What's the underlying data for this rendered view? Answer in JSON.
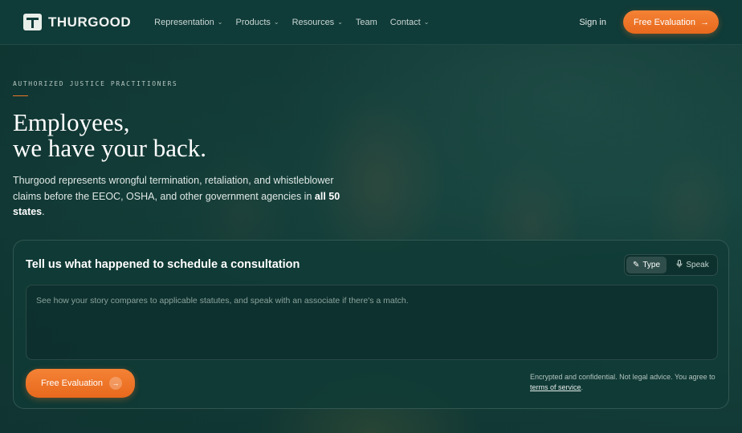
{
  "brand": {
    "name": "THURGOOD"
  },
  "nav": {
    "items": [
      {
        "label": "Representation",
        "has_dropdown": true
      },
      {
        "label": "Products",
        "has_dropdown": true
      },
      {
        "label": "Resources",
        "has_dropdown": true
      },
      {
        "label": "Team",
        "has_dropdown": false
      },
      {
        "label": "Contact",
        "has_dropdown": true
      }
    ],
    "signin_label": "Sign in",
    "cta_label": "Free Evaluation"
  },
  "hero": {
    "eyebrow": "AUTHORIZED JUSTICE PRACTITIONERS",
    "headline_line1": "Employees,",
    "headline_line2": "we have your back.",
    "subtext_prefix": "Thurgood represents wrongful termination, retaliation, and whistleblower claims before the EEOC, OSHA, and other government agencies in ",
    "subtext_bold": "all 50 states",
    "subtext_suffix": "."
  },
  "consultation": {
    "title": "Tell us what happened to schedule a consultation",
    "mode_type_label": "Type",
    "mode_speak_label": "Speak",
    "active_mode": "Type",
    "input_value": "",
    "input_placeholder": "See how your story compares to applicable statutes, and speak with an associate if there's a match.",
    "cta_label": "Free Evaluation",
    "disclaimer_text": "Encrypted and confidential. Not legal advice. You agree to ",
    "disclaimer_link": "terms of service",
    "disclaimer_end": "."
  },
  "colors": {
    "accent": "#f07a2e",
    "background": "#0f3b38"
  }
}
